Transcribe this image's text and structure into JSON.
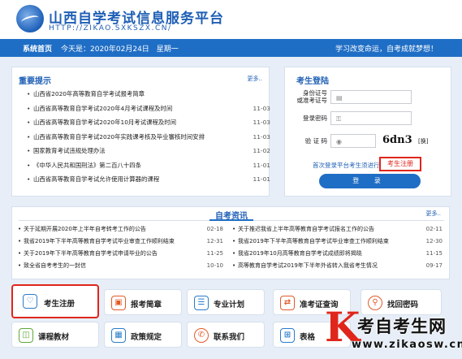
{
  "header": {
    "title": "山西自学考试信息服务平台",
    "url": "HTTP://ZIKAO.SXKSZX.CN/"
  },
  "nav": {
    "home": "系统首页",
    "date": "今天是：2020年02月24日　星期一",
    "slogan": "学习改变命运，自考成就梦想！"
  },
  "notices": {
    "title": "重要提示",
    "more": "更多..",
    "items": [
      {
        "text": "山西省2020年高等教育自学考试报考简章",
        "date": ""
      },
      {
        "text": "山西省高等教育自学考试2020年4月考试课程及时间",
        "date": "11-03"
      },
      {
        "text": "山西省高等教育自学考试2020年10月考试课程及时间",
        "date": "11-03"
      },
      {
        "text": "山西省高等教育自学考试2020年实践课考核及毕业審核时间安排",
        "date": "11-03"
      },
      {
        "text": "国家教育考试违规处理办法",
        "date": "11-02"
      },
      {
        "text": "《中华人民共和国刑法》第二百八十四条",
        "date": "11-01"
      },
      {
        "text": "山西省高等教育自学考试允许使用计算器的课程",
        "date": "11-01"
      }
    ]
  },
  "login": {
    "title": "考生登陆",
    "id_label_1": "身份证号",
    "id_label_2": "或准考证号",
    "password_label": "登录密码",
    "captcha_label": "验 证 码",
    "captcha_value": "6dn3",
    "captcha_refresh": "[换]",
    "register_prompt": "首次登录平台考生须进行",
    "register_link": "考生注册",
    "submit": "登 录"
  },
  "news": {
    "title": "自考资讯",
    "more": "更多..",
    "left": [
      {
        "text": "关于延期开展2020年上半年自考转考工作的公告",
        "date": "02-18"
      },
      {
        "text": "我省2019年下半年高等教育自学考试毕业审查工作顺利结束",
        "date": "12-31"
      },
      {
        "text": "关于2019年下半年高等教育自学考试申请毕业的公告",
        "date": "11-25"
      },
      {
        "text": "致全省自考考生的一封信",
        "date": "10-10"
      }
    ],
    "right": [
      {
        "text": "关于推迟我省上半年高等教育自学考试报名工作的公告",
        "date": "02-11"
      },
      {
        "text": "我省2019年下半年高等教育自学考试毕业审查工作顺利结束",
        "date": "12-30"
      },
      {
        "text": "我省2019年10月高等教育自学考试成绩即将揭晓",
        "date": "11-15"
      },
      {
        "text": "高等教育自学考试2019年下半年外省转入我省考生情况",
        "date": "09-17"
      }
    ]
  },
  "tiles": {
    "register": "考生注册",
    "apply": "报考简章",
    "plan": "专业计划",
    "ticket": "准考证查询",
    "recover": "找回密码",
    "materials": "课程教材",
    "policy": "政策规定",
    "contact": "联系我们",
    "forms": "表格"
  },
  "watermark": {
    "letter": "K",
    "main": "考自考生网",
    "url": "www.zikaosw.cn"
  },
  "colors": {
    "brand_blue": "#1f6ec5",
    "accent_red": "#e0251b",
    "page_bg": "#e7eef7"
  }
}
